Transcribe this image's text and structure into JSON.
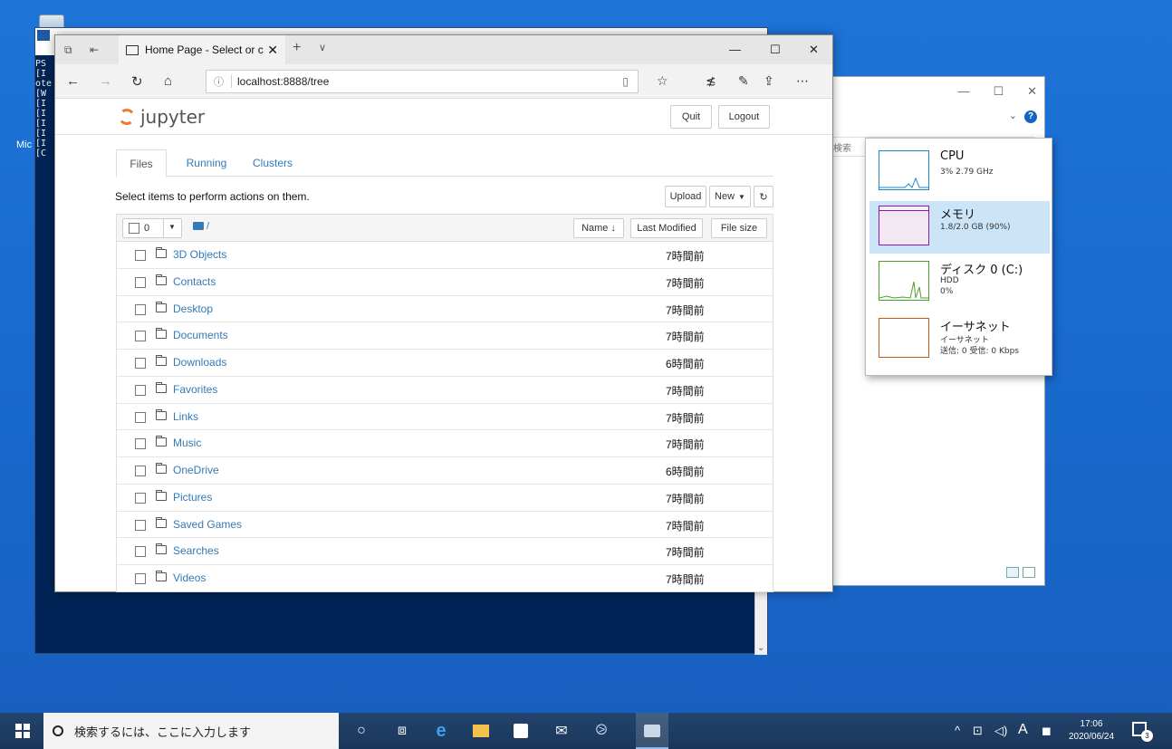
{
  "desktop": {
    "side_label": "Mic"
  },
  "powershell": {
    "text_lines": [
      "PS",
      "[I",
      "ote",
      "[W",
      "[I",
      "[I",
      "[I",
      "[I",
      "[I",
      "[C"
    ]
  },
  "explorer": {
    "minimize": "—",
    "maximize": "☐",
    "close": "✕",
    "search_placeholder": "検索"
  },
  "task_manager": {
    "items": [
      {
        "name": "CPU",
        "line1": "3% 2.79 GHz",
        "line2": "",
        "color": "#1a86c8"
      },
      {
        "name": "メモリ",
        "line1": "1.8/2.0 GB (90%)",
        "line2": "",
        "color": "#8b1aa8"
      },
      {
        "name": "ディスク 0 (C:)",
        "line1": "HDD",
        "line2": "0%",
        "color": "#4aa02c"
      },
      {
        "name": "イーサネット",
        "line1": "イーサネット",
        "line2": "送信: 0 受信: 0 Kbps",
        "color": "#c35a1a"
      }
    ],
    "memory_usage_fraction": 0.9
  },
  "browser": {
    "tab_title": "Home Page - Select or c",
    "tab_close": "✕",
    "new_tab": "+",
    "tab_dropdown": "∨",
    "minimize": "—",
    "maximize": "☐",
    "close": "✕",
    "address": "localhost:8888/tree"
  },
  "jupyter": {
    "logo_text": "jupyter",
    "quit_label": "Quit",
    "logout_label": "Logout",
    "tabs": [
      "Files",
      "Running",
      "Clusters"
    ],
    "hint": "Select items to perform actions on them.",
    "upload_label": "Upload",
    "new_label": "New",
    "selected_count": "0",
    "path": "/",
    "columns": {
      "name": "Name",
      "modified": "Last Modified",
      "size": "File size"
    },
    "rows": [
      {
        "name": "3D Objects",
        "modified": "7時間前"
      },
      {
        "name": "Contacts",
        "modified": "7時間前"
      },
      {
        "name": "Desktop",
        "modified": "7時間前"
      },
      {
        "name": "Documents",
        "modified": "7時間前"
      },
      {
        "name": "Downloads",
        "modified": "6時間前"
      },
      {
        "name": "Favorites",
        "modified": "7時間前"
      },
      {
        "name": "Links",
        "modified": "7時間前"
      },
      {
        "name": "Music",
        "modified": "7時間前"
      },
      {
        "name": "OneDrive",
        "modified": "6時間前"
      },
      {
        "name": "Pictures",
        "modified": "7時間前"
      },
      {
        "name": "Saved Games",
        "modified": "7時間前"
      },
      {
        "name": "Searches",
        "modified": "7時間前"
      },
      {
        "name": "Videos",
        "modified": "7時間前"
      }
    ]
  },
  "taskbar": {
    "search_placeholder": "検索するには、ここに入力します",
    "tray_ime": "A",
    "time": "17:06",
    "date": "2020/06/24",
    "notification_count": "3"
  }
}
